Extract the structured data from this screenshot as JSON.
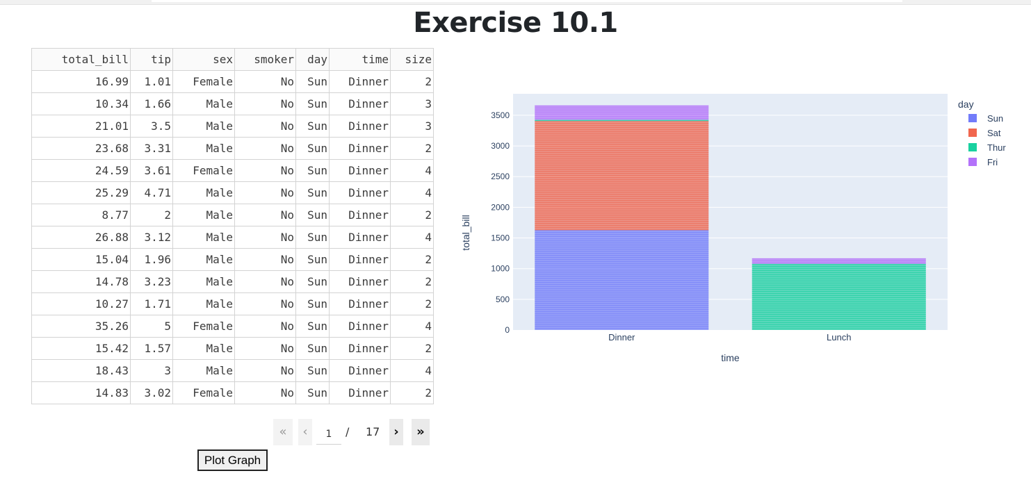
{
  "page": {
    "title": "Exercise 10.1"
  },
  "table": {
    "columns": [
      "total_bill",
      "tip",
      "sex",
      "smoker",
      "day",
      "time",
      "size"
    ],
    "rows": [
      [
        "16.99",
        "1.01",
        "Female",
        "No",
        "Sun",
        "Dinner",
        "2"
      ],
      [
        "10.34",
        "1.66",
        "Male",
        "No",
        "Sun",
        "Dinner",
        "3"
      ],
      [
        "21.01",
        "3.5",
        "Male",
        "No",
        "Sun",
        "Dinner",
        "3"
      ],
      [
        "23.68",
        "3.31",
        "Male",
        "No",
        "Sun",
        "Dinner",
        "2"
      ],
      [
        "24.59",
        "3.61",
        "Female",
        "No",
        "Sun",
        "Dinner",
        "4"
      ],
      [
        "25.29",
        "4.71",
        "Male",
        "No",
        "Sun",
        "Dinner",
        "4"
      ],
      [
        "8.77",
        "2",
        "Male",
        "No",
        "Sun",
        "Dinner",
        "2"
      ],
      [
        "26.88",
        "3.12",
        "Male",
        "No",
        "Sun",
        "Dinner",
        "4"
      ],
      [
        "15.04",
        "1.96",
        "Male",
        "No",
        "Sun",
        "Dinner",
        "2"
      ],
      [
        "14.78",
        "3.23",
        "Male",
        "No",
        "Sun",
        "Dinner",
        "2"
      ],
      [
        "10.27",
        "1.71",
        "Male",
        "No",
        "Sun",
        "Dinner",
        "2"
      ],
      [
        "35.26",
        "5",
        "Female",
        "No",
        "Sun",
        "Dinner",
        "4"
      ],
      [
        "15.42",
        "1.57",
        "Male",
        "No",
        "Sun",
        "Dinner",
        "2"
      ],
      [
        "18.43",
        "3",
        "Male",
        "No",
        "Sun",
        "Dinner",
        "4"
      ],
      [
        "14.83",
        "3.02",
        "Female",
        "No",
        "Sun",
        "Dinner",
        "2"
      ]
    ]
  },
  "pagination": {
    "current": "1",
    "separator": "/",
    "total": "17",
    "first_icon": "double-chevron-left-icon",
    "prev_icon": "chevron-left-icon",
    "next_icon": "chevron-right-icon",
    "last_icon": "double-chevron-right-icon"
  },
  "buttons": {
    "plot_graph": "Plot Graph"
  },
  "chart_data": {
    "type": "bar",
    "stacked": true,
    "categories": [
      "Dinner",
      "Lunch"
    ],
    "series": [
      {
        "name": "Sun",
        "color": "#636efa",
        "values": [
          1627.16,
          0
        ]
      },
      {
        "name": "Sat",
        "color": "#ef553b",
        "values": [
          1778.4,
          0
        ]
      },
      {
        "name": "Thur",
        "color": "#00cc96",
        "values": [
          18.78,
          1077.55
        ]
      },
      {
        "name": "Fri",
        "color": "#ab63fa",
        "values": [
          235.96,
          89.92
        ]
      }
    ],
    "xlabel": "time",
    "ylabel": "total_bill",
    "legend_title": "day",
    "legend_position": "top-right",
    "yticks": [
      0,
      500,
      1000,
      1500,
      2000,
      2500,
      3000,
      3500
    ],
    "ylim": [
      0,
      3850
    ],
    "grid": true,
    "background": "#e5ecf6"
  }
}
